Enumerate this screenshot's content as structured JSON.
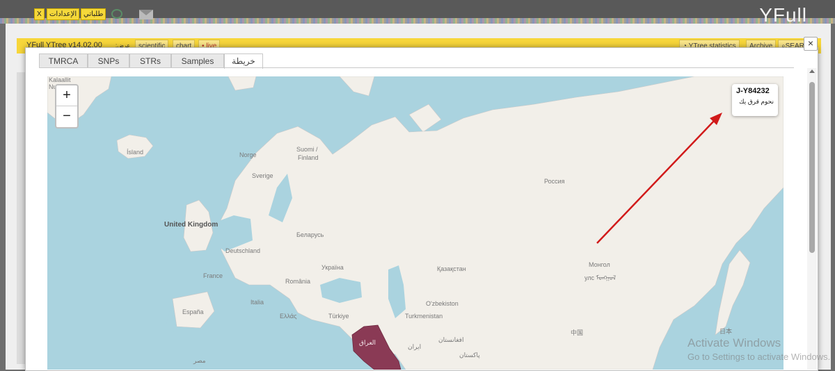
{
  "topbar": {
    "buttons": [
      "X",
      "الإعدادات",
      "طلباتي"
    ],
    "brand": "YFull"
  },
  "page": {
    "title": "YFull YTree v14.02.00",
    "display_label": ":عرض",
    "view_buttons": [
      "scientific",
      "chart",
      "• live"
    ],
    "right_buttons": [
      "YTree statistics",
      "Archive",
      "SEAR"
    ]
  },
  "modal": {
    "close": "×",
    "tabs": [
      "TMRCA",
      "SNPs",
      "STRs",
      "Samples",
      "خريطة"
    ],
    "active_tab": "خريطة"
  },
  "map": {
    "zoom_in": "+",
    "zoom_out": "−",
    "popup": {
      "haplogroup": "J-Y84232",
      "note": "نحوم قرق يك"
    },
    "highlight_color": "#8a3a55",
    "arrow_color": "#d11a1a",
    "labels": {
      "kalaallit": "Kalaallit",
      "nunaat": "Nunaat",
      "island": "Ísland",
      "norge": "Norge",
      "suomi": "Suomi /",
      "finland": "Finland",
      "sverige": "Sverige",
      "uk": "United Kingdom",
      "belarus": "Беларусь",
      "deutschland": "Deutschland",
      "ukraina": "Україна",
      "france": "France",
      "romania": "România",
      "italia": "Italia",
      "espana": "España",
      "ellas": "Ελλάς",
      "turkiye": "Türkiye",
      "rossiya": "Россия",
      "kazakhstan": "Қазақстан",
      "mongol": "Монгол",
      "mongol2": "улс ᠮᠤᠩᠭᠤᠯ",
      "uzbekistan": "O'zbekiston",
      "turkmenistan": "Turkmenistan",
      "iraq": "العراق",
      "iran": "ایران",
      "afghanistan": "افغانستان",
      "pakistan": "پاکستان",
      "china": "中国",
      "japan": "日本",
      "egypt": "مصر"
    }
  },
  "watermark": {
    "line1": "Activate Windows",
    "line2": "Go to Settings to activate Windows."
  }
}
